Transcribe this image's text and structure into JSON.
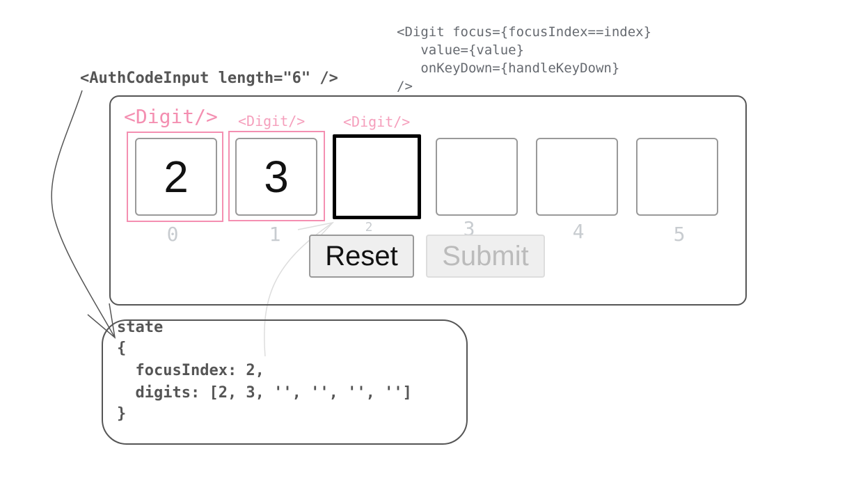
{
  "component_label": "<AuthCodeInput length=\"6\" />",
  "digit_props_code": [
    "<Digit focus={focusIndex==index}",
    "   value={value}",
    "   onKeyDown={handleKeyDown}",
    "/>"
  ],
  "digit_tags": [
    "<Digit/>",
    "<Digit/>",
    "<Digit/>"
  ],
  "digits": [
    {
      "value": "2",
      "index": "0"
    },
    {
      "value": "3",
      "index": "1"
    },
    {
      "value": "",
      "index": "2"
    },
    {
      "value": "",
      "index": "3"
    },
    {
      "value": "",
      "index": "4"
    },
    {
      "value": "",
      "index": "5"
    }
  ],
  "focus_index": 2,
  "buttons": {
    "reset": "Reset",
    "submit": "Submit"
  },
  "state": [
    "state",
    "{",
    "  focusIndex: 2,",
    "  digits: [2, 3, '', '', '', '']",
    "}"
  ],
  "colors": {
    "pink": "#f48fb1",
    "outline": "#555555",
    "focus": "#000000"
  }
}
